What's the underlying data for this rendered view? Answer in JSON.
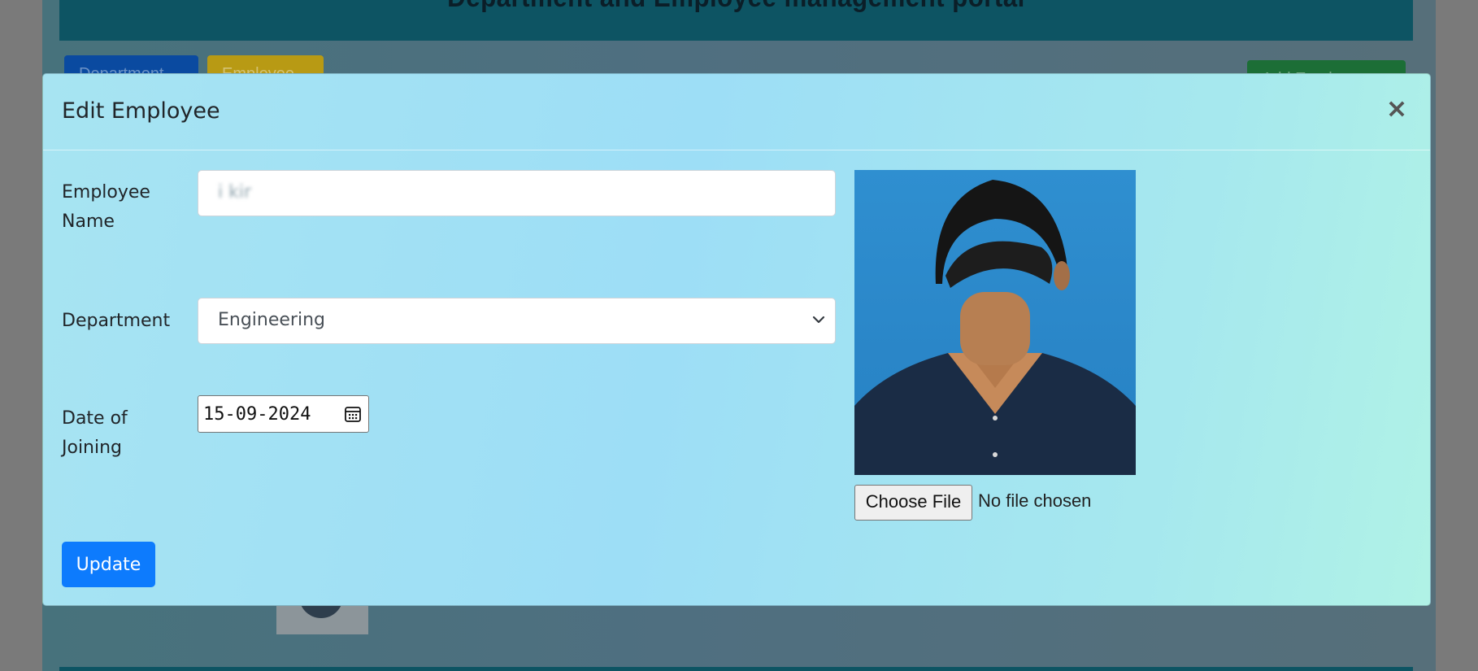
{
  "background": {
    "header_title": "Department and Employee management portal",
    "buttons": {
      "departments": "Department",
      "employees": "Employee",
      "add_employee": "Add Employee"
    }
  },
  "modal": {
    "title": "Edit Employee",
    "close_label": "×",
    "fields": {
      "employee_name": {
        "label": "Employee Name",
        "value": "i     kir"
      },
      "department": {
        "label": "Department",
        "selected": "Engineering"
      },
      "date_of_joining": {
        "label": "Date of Joining",
        "value": "15-09-2024"
      }
    },
    "photo": {
      "choose_file_label": "Choose File",
      "file_status": "No file chosen"
    },
    "update_label": "Update"
  },
  "colors": {
    "primary": "#0d7bfd",
    "header_bg": "#0d5463",
    "modal_gradient_start": "#a7e4f2",
    "modal_gradient_end": "#b0f2e6"
  },
  "icons": [
    "close-icon",
    "chevron-down-icon",
    "calendar-icon",
    "employee-photo"
  ]
}
